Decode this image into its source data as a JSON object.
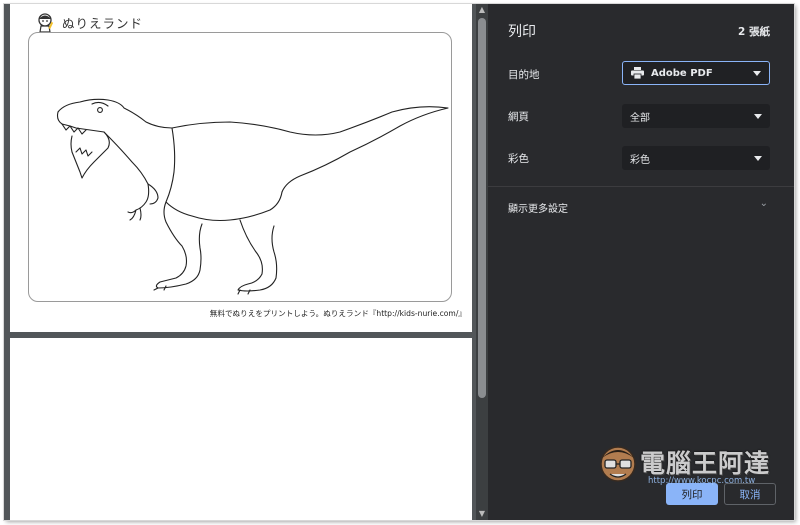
{
  "preview": {
    "site_name": "ぬりえランド",
    "footer_credit": "無料でぬりえをプリントしよう。ぬりえランド『http://kids-nurie.com/』"
  },
  "dialog": {
    "title": "列印",
    "sheet_count": "2 張紙",
    "destination_label": "目的地",
    "destination_value": "Adobe PDF",
    "pages_label": "網頁",
    "pages_value": "全部",
    "color_label": "彩色",
    "color_value": "彩色",
    "more_settings": "顯示更多設定",
    "print_button": "列印",
    "cancel_button": "取消"
  },
  "watermark": {
    "text": "電腦王阿達",
    "url": "http://www.kocpc.com.tw"
  },
  "colors": {
    "panel_bg": "#292a2d",
    "accent": "#8ab4f8",
    "preview_bg": "#525659"
  }
}
